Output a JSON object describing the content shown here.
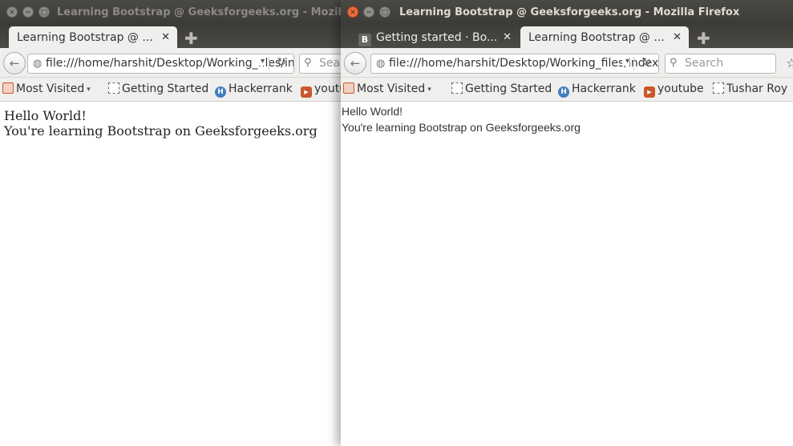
{
  "left_window": {
    "title": "Learning Bootstrap @ Geeksforgeeks.org - Mozilla Firefox",
    "tabs": [
      {
        "label": "Learning Bootstrap @ ...",
        "active": true
      }
    ],
    "url": "file:///home/harshit/Desktop/Working_files/index.html",
    "search_placeholder": "Search",
    "bookmarks": [
      "Most Visited",
      "Getting Started",
      "Hackerrank",
      "youtube"
    ],
    "content": {
      "line1": "Hello World!",
      "line2": "You're learning Bootstrap on Geeksforgeeks.org"
    }
  },
  "right_window": {
    "title": "Learning Bootstrap @ Geeksforgeeks.org - Mozilla Firefox",
    "tabs": [
      {
        "label": "Getting started · Bo...",
        "icon_text": "B",
        "active": false
      },
      {
        "label": "Learning Bootstrap @ ...",
        "active": true
      }
    ],
    "url": "file:///home/harshit/Desktop/Working_files/index.html",
    "search_placeholder": "Search",
    "bookmarks": [
      "Most Visited",
      "Getting Started",
      "Hackerrank",
      "youtube",
      "Tushar Roy"
    ],
    "content": {
      "line1": "Hello World!",
      "line2": "You're learning Bootstrap on Geeksforgeeks.org"
    }
  },
  "colors": {
    "titlebar": "#3c3b37",
    "active_tab": "#f0efed",
    "close_button": "#f06b3c"
  },
  "icons": {
    "close": "✕",
    "minimize": "−",
    "maximize": "□",
    "new_tab": "✚",
    "back": "←",
    "globe": "◍",
    "dropdown": "▾",
    "reload": "↻",
    "search": "⚲",
    "bookmark_star": "☆"
  }
}
